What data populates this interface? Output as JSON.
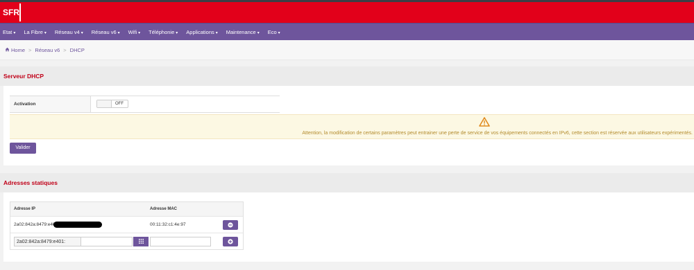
{
  "brand": {
    "logo": "SFR"
  },
  "nav": [
    {
      "label": "Etat"
    },
    {
      "label": "La Fibre"
    },
    {
      "label": "Réseau v4"
    },
    {
      "label": "Réseau v6"
    },
    {
      "label": "Wifi"
    },
    {
      "label": "Téléphonie"
    },
    {
      "label": "Applications"
    },
    {
      "label": "Maintenance"
    },
    {
      "label": "Eco"
    }
  ],
  "breadcrumb": {
    "items": [
      "Home",
      "Réseau v6",
      "DHCP"
    ],
    "separator": ">"
  },
  "dhcp": {
    "title": "Serveur DHCP",
    "activation_label": "Activation",
    "toggle_state": "OFF",
    "alert": "Attention, la modification de certains paramètres peut entrainer une perte de service de vos équipements connectés en IPv6, cette section est réservée aux utilisateurs expérimentés.",
    "submit_label": "Valider"
  },
  "static": {
    "title": "Adresses statiques",
    "headers": [
      "Adresse IP",
      "Adresse MAC"
    ],
    "rows": [
      {
        "ip": "2a02:842a:8479:e401",
        "mac": "00:11:32:c1:4e:97"
      }
    ],
    "new_ip_prefix": "2a02:842a:8479:e401:",
    "new_mac_value": ""
  },
  "icons": {
    "home": "home-icon",
    "caret": "caret-down-icon",
    "warning": "warning-triangle-icon",
    "remove": "minus-circle-icon",
    "add": "plus-circle-icon",
    "grid": "grid-icon"
  },
  "colors": {
    "brand_red": "#e2001a",
    "nav_purple": "#6e559c",
    "title_red": "#c00018",
    "alert_bg": "#fcf8e3",
    "alert_text": "#b38b2d"
  }
}
